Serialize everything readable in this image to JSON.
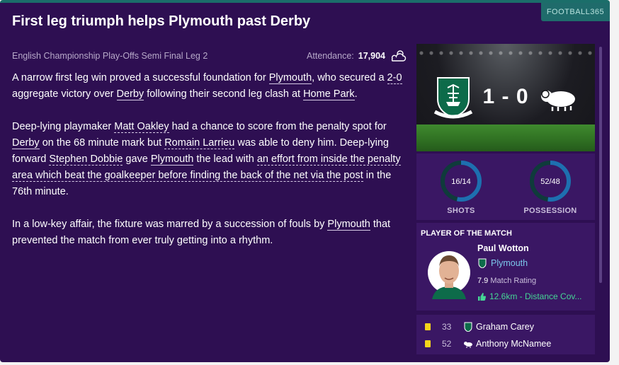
{
  "brand": "FOOTBALL365",
  "headline": "First leg triumph helps Plymouth past Derby",
  "competition": "English Championship Play-Offs Semi Final Leg 2",
  "attendance_label": "Attendance:",
  "attendance_value": "17,904",
  "weather_icon": "partly-cloudy-icon",
  "paragraphs": {
    "p1": {
      "t1": "A narrow first leg win proved a successful foundation for ",
      "l1": "Plymouth",
      "t2": ", who secured a ",
      "l2": "2-0",
      "t3": " aggregate victory over ",
      "l3": "Derby",
      "t4": " following their second leg clash at ",
      "l4": "Home Park",
      "t5": "."
    },
    "p2": {
      "t1": "Deep-lying playmaker ",
      "l1": "Matt Oakley",
      "t2": " had a chance to score from the penalty spot for ",
      "l2": "Derby",
      "t3": " on the 68 minute mark but ",
      "l3": "Romain Larrieu",
      "t4": " was able to deny him. Deep-lying forward ",
      "l4": "Stephen Dobbie",
      "t5": " gave ",
      "l5": "Plymouth",
      "t6": " the lead with ",
      "l6": "an effort from inside the penalty area which beat the goalkeeper before finding the back of the net via the post",
      "t7": " in the 76th minute."
    },
    "p3": {
      "t1": "In a low-key affair, the fixture was marred by a succession of fouls by ",
      "l1": "Plymouth",
      "t2": " that prevented the match from ever truly getting into a rhythm."
    }
  },
  "score": "1 - 0",
  "stats": {
    "shots": {
      "value": "16/14",
      "label": "SHOTS",
      "home_fraction": 0.533
    },
    "possession": {
      "value": "52/48",
      "label": "POSSESSION",
      "home_fraction": 0.52
    }
  },
  "potm": {
    "title": "PLAYER OF THE MATCH",
    "name": "Paul Wotton",
    "club": "Plymouth",
    "rating_value": "7.9",
    "rating_label": "Match Rating",
    "highlight": "12.6km - Distance Cov..."
  },
  "events": [
    {
      "minute": "33",
      "player": "Graham Carey",
      "team_icon": "plymouth-crest-icon"
    },
    {
      "minute": "52",
      "player": "Anthony McNamee",
      "team_icon": "derby-ram-icon"
    }
  ],
  "colors": {
    "background": "#2e0f52",
    "panel": "#3a1764",
    "accent_teal": "#1f6b6b",
    "home_ring": "#1e6fb0",
    "away_ring": "#0f3b3b",
    "link_blue": "#7cc8ec",
    "positive_green": "#45d695",
    "yellow_card": "#f3d41a"
  }
}
